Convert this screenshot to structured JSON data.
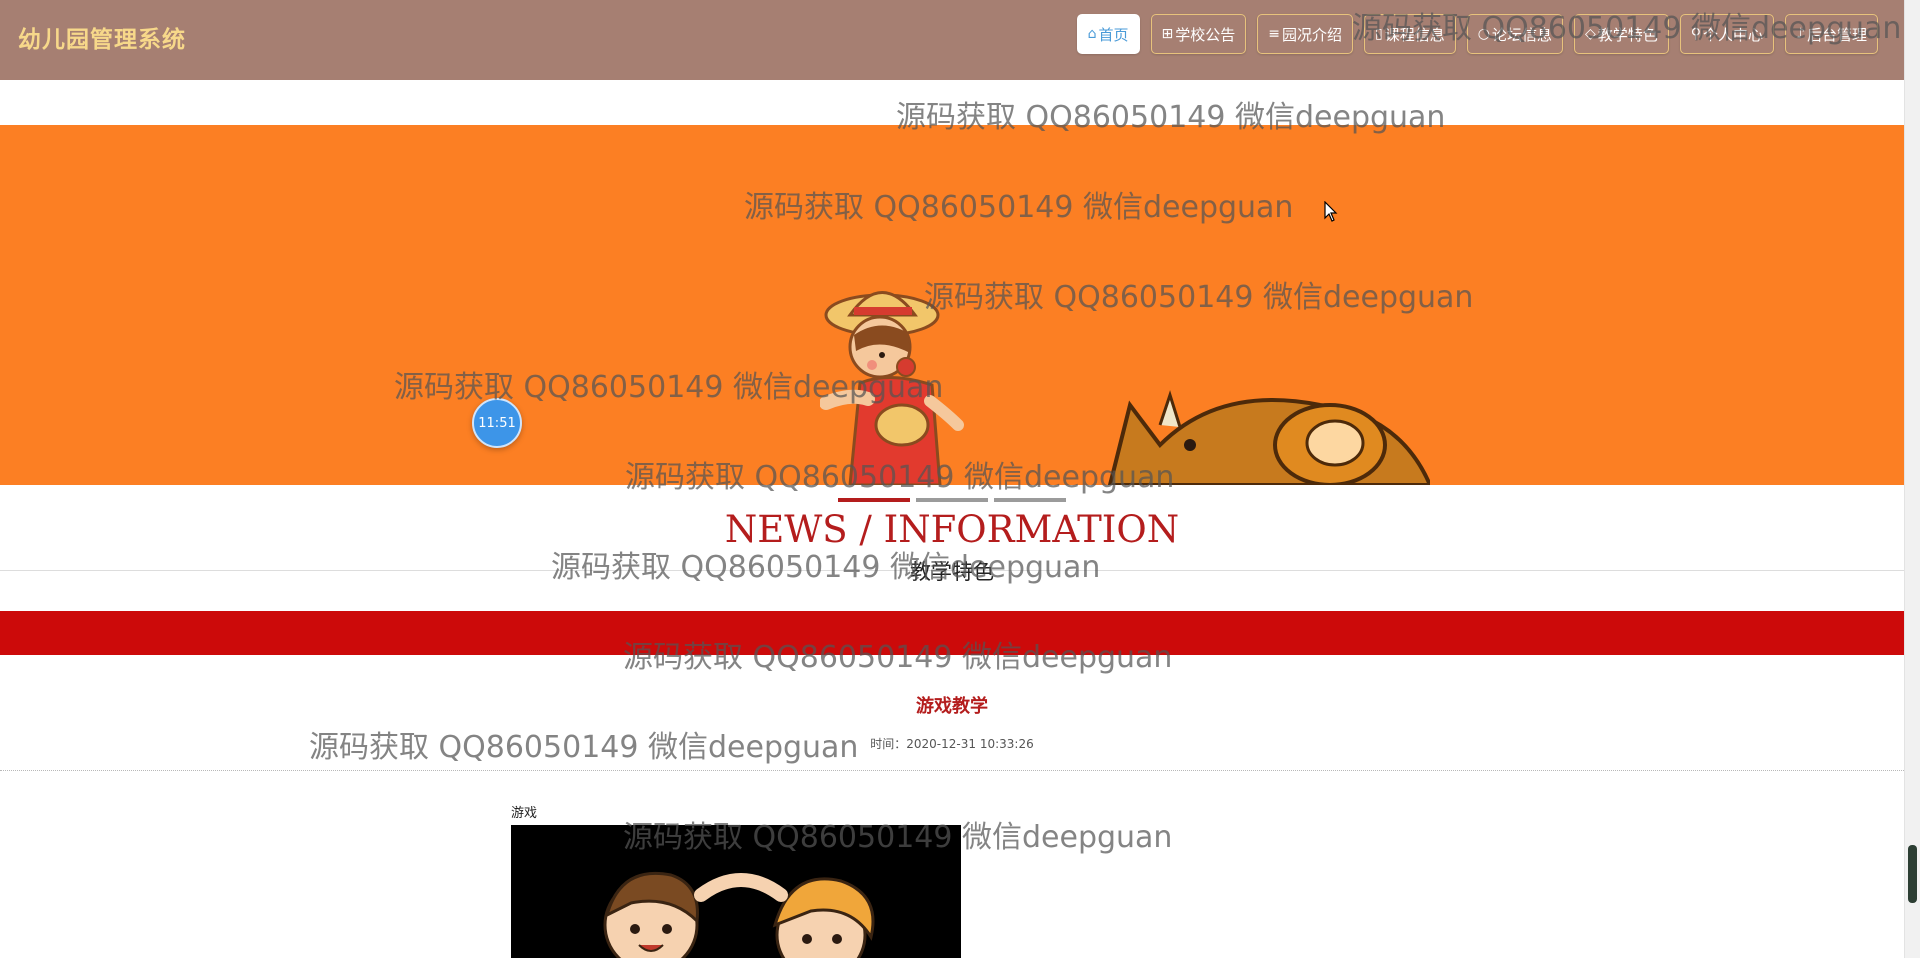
{
  "header": {
    "logo": "幼儿园管理系统",
    "nav": [
      {
        "icon": "⌂",
        "label": "首页",
        "active": true
      },
      {
        "icon": "⊞",
        "label": "学校公告"
      },
      {
        "icon": "≡",
        "label": "园况介绍"
      },
      {
        "icon": "▯",
        "label": "课程信息"
      },
      {
        "icon": "○",
        "label": "论坛信息"
      },
      {
        "icon": "◇",
        "label": "教学特色"
      },
      {
        "icon": "⚲",
        "label": "个人中心"
      },
      {
        "icon": "♪",
        "label": "后台管理"
      }
    ]
  },
  "banner": {
    "clock": "11:51",
    "slides": 3,
    "active_slide": 0
  },
  "section": {
    "title": "NEWS / INFORMATION",
    "subtitle": "教学特色"
  },
  "article": {
    "title": "游戏教学",
    "time": "时间：2020-12-31 10:33:26",
    "caption": "游戏"
  },
  "watermark": "源码获取 QQ86050149 微信deepguan",
  "colors": {
    "header": "#a67f72",
    "logo": "#f7d88a",
    "banner": "#fc7f23",
    "accent_red": "#b41d1d",
    "red_bar": "#cc0a0a"
  }
}
